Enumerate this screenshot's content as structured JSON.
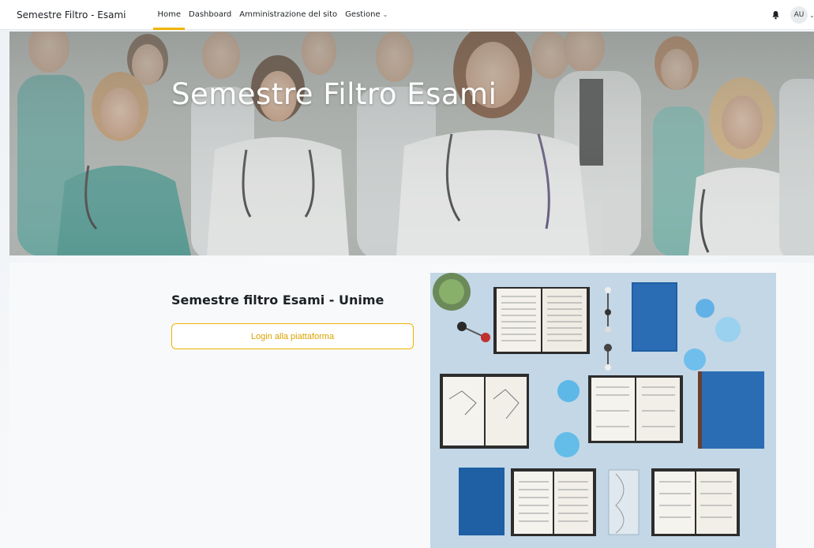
{
  "brand": "Semestre Filtro - Esami",
  "nav": {
    "items": [
      {
        "label": "Home",
        "active": true
      },
      {
        "label": "Dashboard",
        "active": false
      },
      {
        "label": "Amministrazione del sito",
        "active": false
      },
      {
        "label": "Gestione",
        "active": false,
        "has_dropdown": true
      }
    ]
  },
  "user": {
    "initials": "AU",
    "icon": "bell-icon"
  },
  "hero": {
    "title": "Semestre Filtro Esami"
  },
  "main": {
    "section_title": "Semestre filtro Esami - Unime",
    "login_label": "Login alla piattaforma"
  },
  "colors": {
    "accent": "#f0b400",
    "primary_text": "#1d2125"
  }
}
